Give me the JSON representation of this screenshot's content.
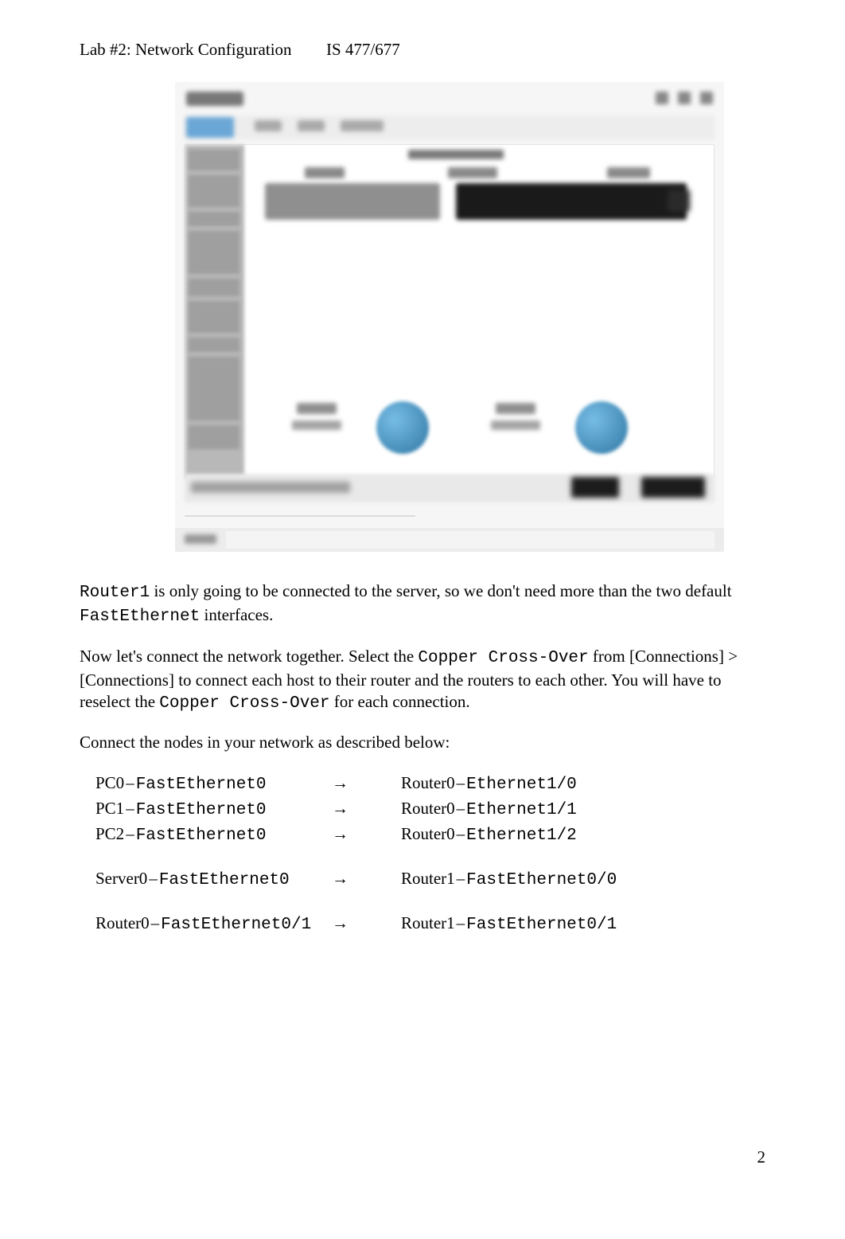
{
  "header": {
    "left": "Lab #2: Network Configuration",
    "right": "IS 477/677"
  },
  "paragraphs": {
    "p1_pre": "",
    "p1_code1": "Router1",
    "p1_mid": " is only going to be connected to the server, so we don't need more than the two default ",
    "p1_code2": "FastEthernet",
    "p1_post": " interfaces.",
    "p2_pre": "Now let's connect the network together. Select the ",
    "p2_code1": "Copper Cross-Over",
    "p2_mid": " from [Connections] > [Connections] to connect each host to their router and the routers to each other. You will have to reselect the ",
    "p2_code2": "Copper Cross-Over",
    "p2_post": "  for each connection.",
    "p3": "Connect the nodes in your network as described below:"
  },
  "arrow": "→",
  "dash": "–",
  "connections": [
    {
      "left_dev": "PC0",
      "left_if": "FastEthernet0",
      "right_dev": "Router0",
      "right_if": "Ethernet1/0"
    },
    {
      "left_dev": "PC1",
      "left_if": "FastEthernet0",
      "right_dev": "Router0",
      "right_if": "Ethernet1/1"
    },
    {
      "left_dev": "PC2",
      "left_if": "FastEthernet0",
      "right_dev": "Router0",
      "right_if": "Ethernet1/2"
    },
    {
      "left_dev": "Server0",
      "left_if": "FastEthernet0",
      "right_dev": "Router1",
      "right_if": "FastEthernet0/0"
    },
    {
      "left_dev": "Router0",
      "left_if": "FastEthernet0/1",
      "right_dev": "Router1",
      "right_if": "FastEthernet0/1"
    }
  ],
  "page_number": "2"
}
